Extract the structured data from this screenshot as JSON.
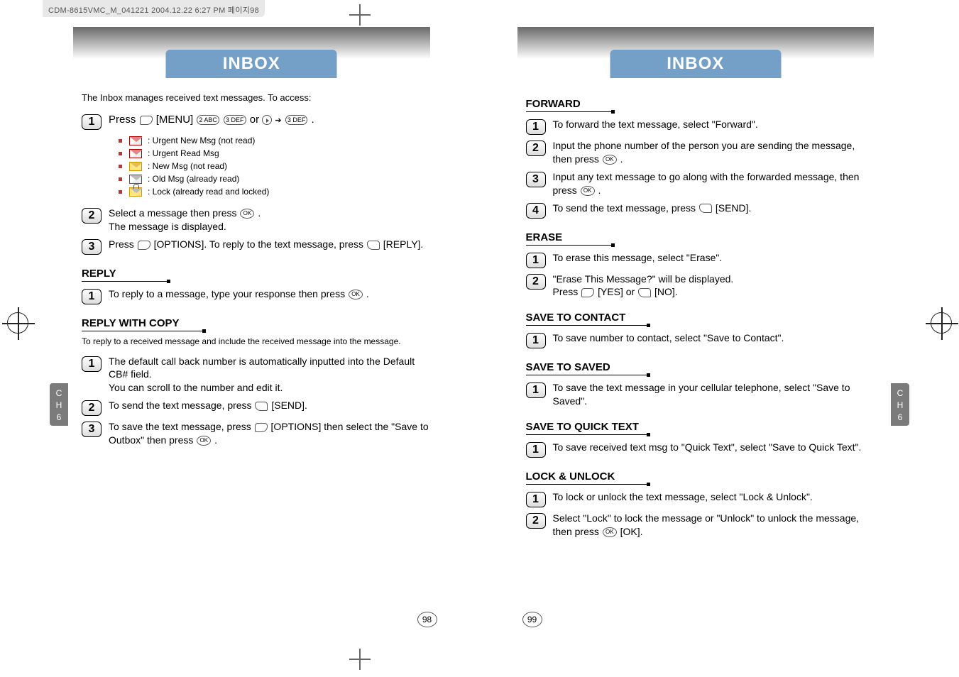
{
  "print_header": "CDM-8615VMC_M_041221  2004.12.22 6:27 PM  페이지98",
  "chapter_tab": {
    "ch": "C\nH",
    "num": "6"
  },
  "page_numbers": {
    "left": "98",
    "right": "99"
  },
  "left": {
    "title": "INBOX",
    "intro": "The Inbox manages received text messages. To access:",
    "step1": {
      "pre": "Press ",
      "a": "[MENU]",
      "b": " or ",
      "end": " ."
    },
    "icons": [
      {
        "cls": "urgent",
        "label": ": Urgent New Msg (not read)"
      },
      {
        "cls": "urgent",
        "label": ": Urgent Read Msg"
      },
      {
        "cls": "new",
        "label": ": New Msg (not read)"
      },
      {
        "cls": "",
        "label": ": Old Msg (already read)"
      },
      {
        "cls": "lock",
        "label": ": Lock (already read and locked)"
      }
    ],
    "step2": "Select a message then press       .\nThe message is displayed.",
    "step3": {
      "a": "Press ",
      "b": "[OPTIONS]. To reply to the text message, press",
      "c": "[REPLY]."
    },
    "sec_reply": "REPLY",
    "reply1": "To reply to a message, type your response then press       .",
    "sec_reply_copy": "REPLY WITH COPY",
    "reply_copy_note": "To reply to a received message and include the received message into the message.",
    "rc1": "The default call back number is automatically inputted into the Default CB# field.\nYou can scroll to the number and edit it.",
    "rc2": {
      "a": "To send the text message, press ",
      "b": "[SEND]."
    },
    "rc3": {
      "a": "To save the text message, press ",
      "b": "[OPTIONS] then select the \"Save to Outbox\" then press       ."
    }
  },
  "right": {
    "title": "INBOX",
    "sec_forward": "FORWARD",
    "fw1": "To forward the text message, select \"Forward\".",
    "fw2": "Input the phone number of the person you are sending the message, then press       .",
    "fw3": "Input any text message to go along with the forwarded message, then press       .",
    "fw4": {
      "a": "To send the text message, press ",
      "b": "[SEND]."
    },
    "sec_erase": "ERASE",
    "er1": "To erase this message, select \"Erase\".",
    "er2": {
      "a": "\"Erase This Message?\" will be displayed.\nPress ",
      "b": " [YES] or ",
      "c": " [NO]."
    },
    "sec_save_contact": "SAVE TO CONTACT",
    "sc1": "To save number to contact, select \"Save to Contact\".",
    "sec_save_saved": "SAVE TO SAVED",
    "ss1": "To save the text message in your cellular telephone, select \"Save to Saved\".",
    "sec_save_quick": "SAVE TO QUICK TEXT",
    "sq1": "To save received text msg to \"Quick Text\", select \"Save to Quick Text\".",
    "sec_lock": "LOCK & UNLOCK",
    "lk1": "To lock or unlock the text message, select \"Lock & Unlock\".",
    "lk2": "Select \"Lock\" to lock the message or \"Unlock\" to unlock the message, then press       [OK]."
  }
}
